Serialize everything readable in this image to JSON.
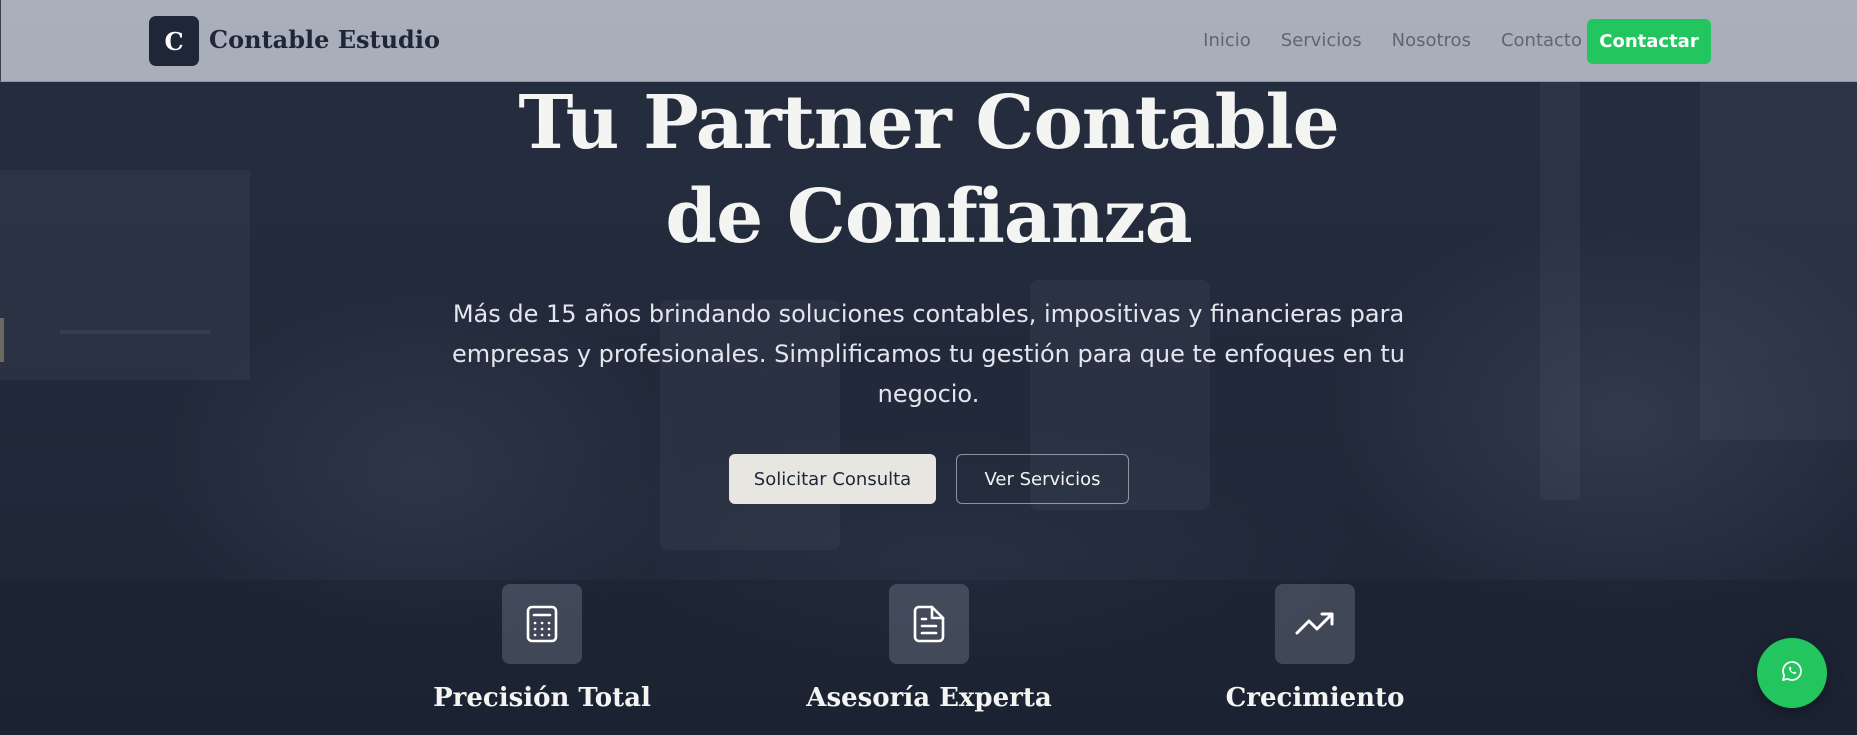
{
  "header": {
    "logo_letter": "C",
    "brand": "Contable Estudio",
    "nav": [
      {
        "label": "Inicio"
      },
      {
        "label": "Servicios"
      },
      {
        "label": "Nosotros"
      },
      {
        "label": "Contacto"
      }
    ],
    "cta_label": "Contactar"
  },
  "hero": {
    "title_line1": "Tu Partner Contable",
    "title_line2": "de Confianza",
    "subtitle": "Más de 15 años brindando soluciones contables, impositivas y financieras para empresas y profesionales. Simplificamos tu gestión para que te enfoques en tu negocio.",
    "primary_button": "Solicitar Consulta",
    "secondary_button": "Ver Servicios"
  },
  "features": [
    {
      "icon": "calculator-icon",
      "title": "Precisión Total"
    },
    {
      "icon": "document-icon",
      "title": "Asesoría Experta"
    },
    {
      "icon": "trending-up-icon",
      "title": "Crecimiento"
    }
  ],
  "floating": {
    "icon": "whatsapp-icon"
  },
  "colors": {
    "brand_dark": "#1e2638",
    "accent_green": "#22c55e",
    "hero_text": "#f4f4f2"
  }
}
